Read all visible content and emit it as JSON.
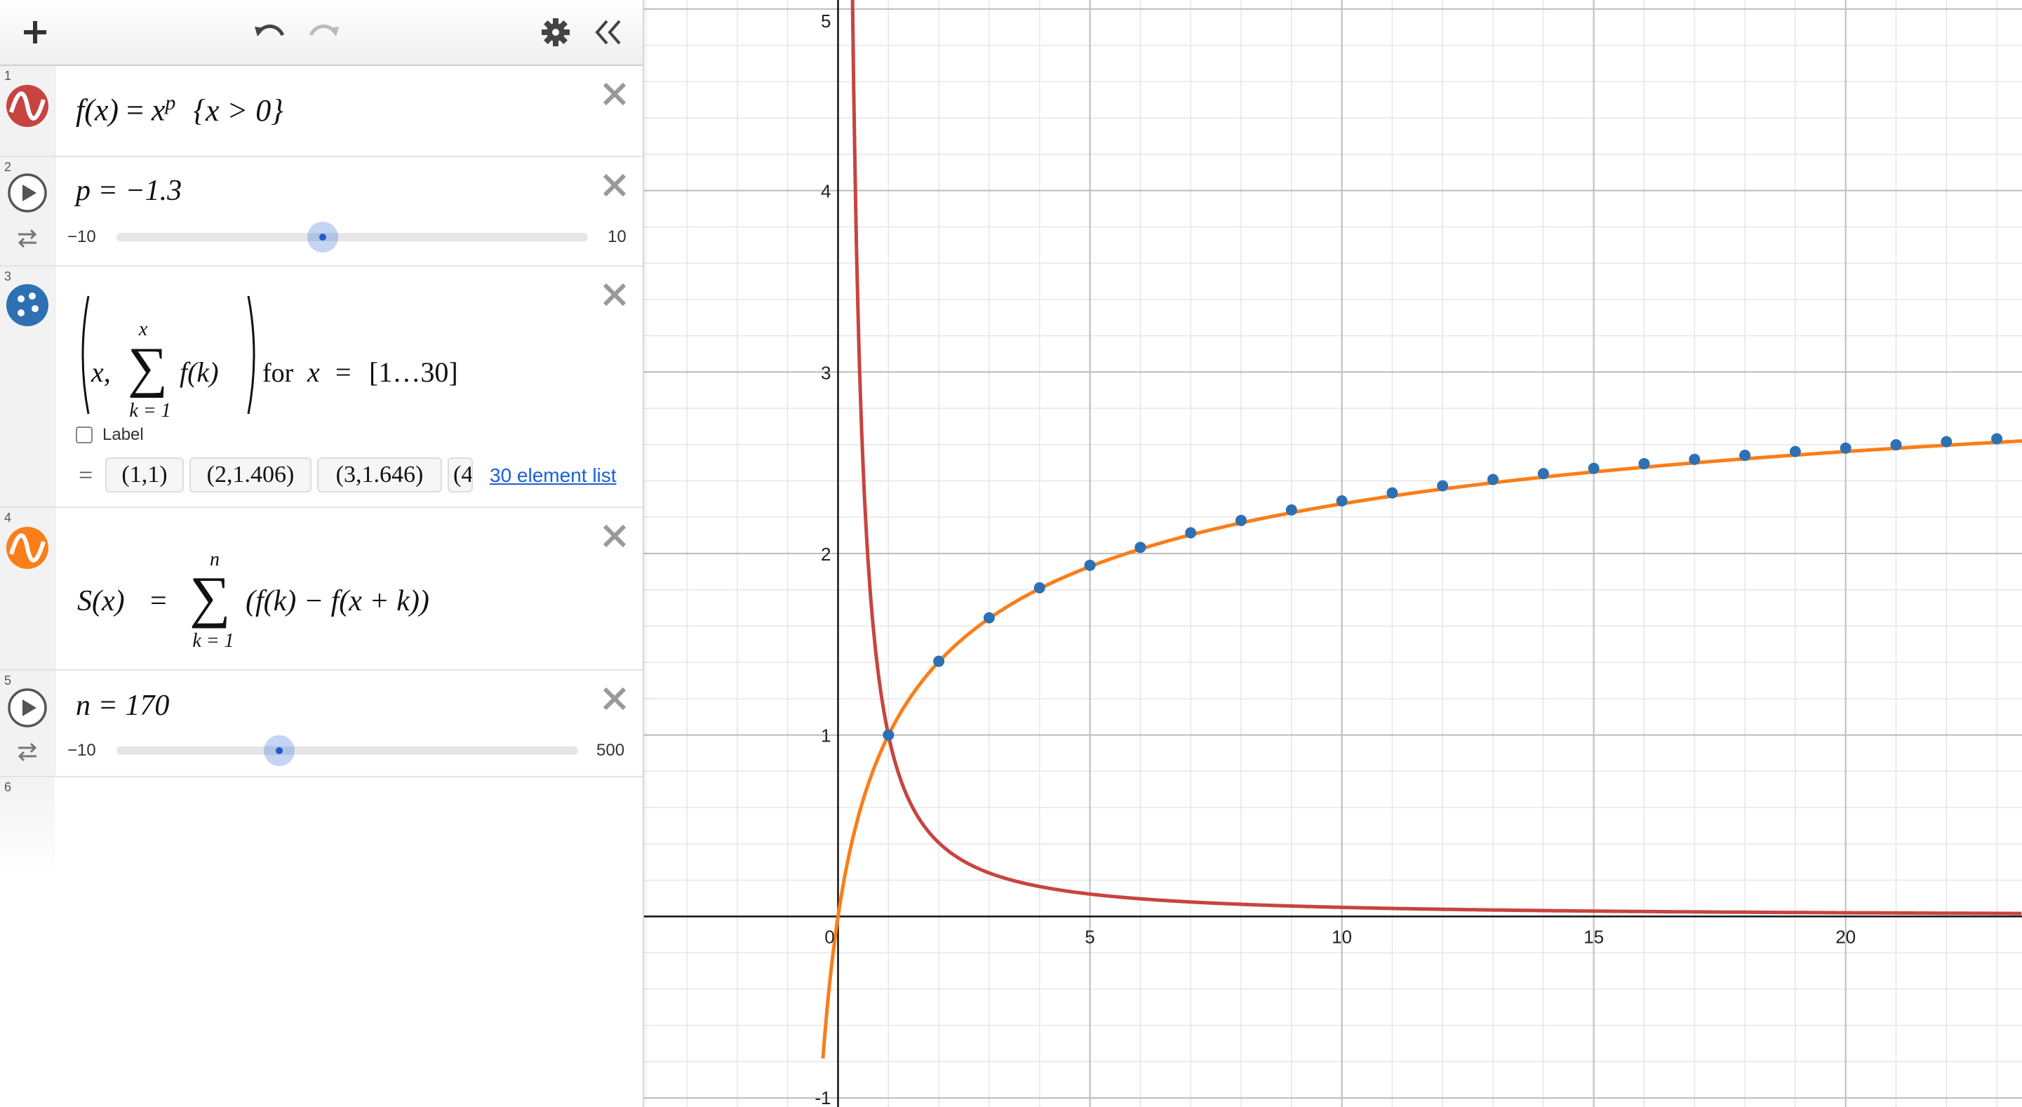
{
  "toolbar": {
    "add_icon": "plus-icon",
    "undo_icon": "undo-icon",
    "redo_icon": "redo-icon",
    "settings_icon": "gear-icon",
    "collapse_icon": "double-chevron-left-icon"
  },
  "expressions": [
    {
      "num": "1",
      "type": "function",
      "color": "#c74440",
      "lhs": "f(x)",
      "rhs_base": "x",
      "rhs_exp": "p",
      "restriction": "{x > 0}"
    },
    {
      "num": "2",
      "type": "slider",
      "text": "p = −1.3",
      "var": "p",
      "value": -1.3,
      "min_label": "−10",
      "max_label": "10",
      "min": -10,
      "max": 10
    },
    {
      "num": "3",
      "type": "points",
      "color": "#2d70b3",
      "x_var": "x,",
      "sum_upper": "x",
      "sum_lower": "k = 1",
      "summand": "f(k)",
      "for_word": "for",
      "for_var": "x",
      "eq": "=",
      "list_text": "[1…30]",
      "label_checkbox": "Label",
      "eq_sign": "=",
      "values": [
        "(1,1)",
        "(2,1.406)",
        "(3,1.646)",
        "(4"
      ],
      "list_link": "30 element list"
    },
    {
      "num": "4",
      "type": "function",
      "color": "#fa7e19",
      "lhs": "S(x)",
      "eq": "=",
      "sum_upper": "n",
      "sum_lower": "k = 1",
      "summand": "(f(k) − f(x + k))"
    },
    {
      "num": "5",
      "type": "slider",
      "text": "n = 170",
      "var": "n",
      "value": 170,
      "min_label": "−10",
      "max_label": "500",
      "min": -10,
      "max": 500
    },
    {
      "num": "6",
      "type": "empty"
    }
  ],
  "chart_data": {
    "type": "line",
    "xlim": [
      -3.85,
      23.5
    ],
    "ylim": [
      -1.05,
      5.05
    ],
    "grid": true,
    "x_ticks": [
      "0",
      "5",
      "10",
      "15",
      "20"
    ],
    "y_ticks": [
      "-1",
      "1",
      "2",
      "3",
      "4",
      "5"
    ],
    "series": [
      {
        "expr": "f(x)",
        "color": "#c74440",
        "kind": "curve",
        "p": -1.3
      },
      {
        "expr": "S(x)",
        "color": "#fa7e19",
        "kind": "curve",
        "n": 170
      },
      {
        "expr": "points",
        "color": "#2d70b3",
        "kind": "scatter",
        "x": [
          1,
          2,
          3,
          4,
          5,
          6,
          7,
          8,
          9,
          10,
          11,
          12,
          13,
          14,
          15,
          16,
          17,
          18,
          19,
          20,
          21,
          22,
          23
        ],
        "y": [
          1,
          1.406,
          1.646,
          1.811,
          1.935,
          2.034,
          2.114,
          2.182,
          2.24,
          2.29,
          2.334,
          2.373,
          2.408,
          2.44,
          2.469,
          2.495,
          2.519,
          2.541,
          2.562,
          2.581,
          2.599,
          2.616,
          2.632
        ]
      }
    ]
  }
}
